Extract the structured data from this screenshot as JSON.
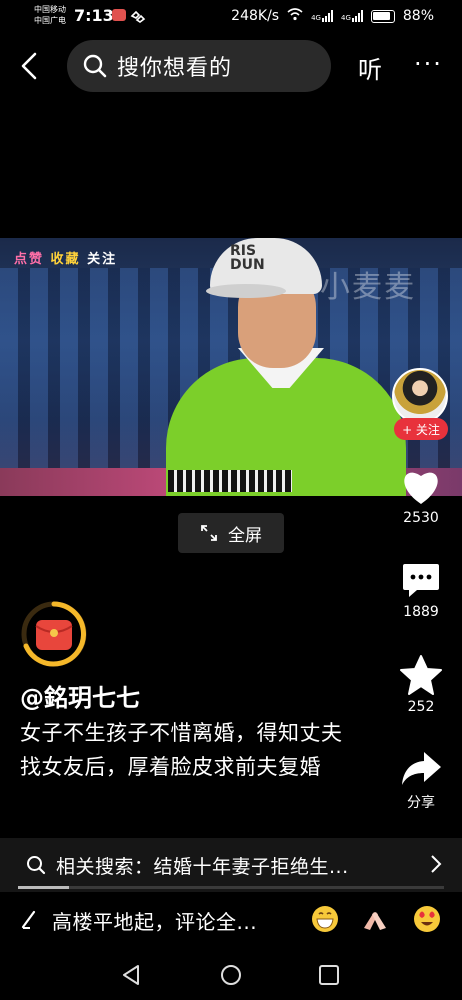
{
  "status_bar": {
    "carrier_line1": "中国移动",
    "carrier_line2": "中国广电",
    "time": "7:13",
    "network_speed": "248K/s",
    "signal_label_1": "4G",
    "signal_label_2": "4G",
    "battery": "88%"
  },
  "top_nav": {
    "search_placeholder": "搜你想看的",
    "listen_label": "听",
    "more_label": "···"
  },
  "video": {
    "overlay_tags": [
      "点赞",
      "收藏",
      "关注"
    ],
    "watermark": "小麦麦",
    "cap_text_line1": "RIS",
    "cap_text_line2": "DUN"
  },
  "fullscreen_label": "全屏",
  "side_actions": {
    "follow_label": "+ 关注",
    "like_count": "2530",
    "comment_count": "1889",
    "favorite_count": "252",
    "share_label": "分享"
  },
  "post": {
    "author": "@銘玥七七",
    "description": "女子不生孩子不惜离婚，得知丈夫找女友后，厚着脸皮求前夫复婚"
  },
  "related_search": {
    "text": "相关搜索：结婚十年妻子拒绝生..."
  },
  "playback_progress": 0.12,
  "comment_bar": {
    "placeholder": "高楼平地起，评论全..."
  },
  "colors": {
    "accent_red": "#e8323c",
    "background": "#000000",
    "shirt_green": "#7ccf2a"
  }
}
